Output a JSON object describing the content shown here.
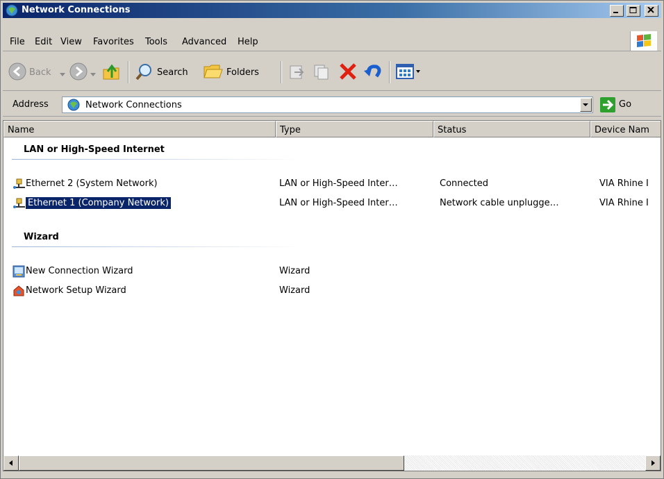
{
  "window": {
    "title": "Network Connections"
  },
  "menu": [
    "File",
    "Edit",
    "View",
    "Favorites",
    "Tools",
    "Advanced",
    "Help"
  ],
  "toolbar": {
    "back_label": "Back",
    "search_label": "Search",
    "folders_label": "Folders"
  },
  "address": {
    "label": "Address",
    "value": "Network Connections",
    "go_label": "Go"
  },
  "columns": [
    "Name",
    "Type",
    "Status",
    "Device Nam"
  ],
  "groups": [
    {
      "title": "LAN or High-Speed Internet",
      "items": [
        {
          "name": "Ethernet 2 (System Network)",
          "type": "LAN or High-Speed Inter…",
          "status": "Connected",
          "device": "VIA Rhine I",
          "icon": "lan-connection-icon",
          "selected": false
        },
        {
          "name": "Ethernet 1 (Company Network)",
          "type": "LAN or High-Speed Inter…",
          "status": "Network cable unplugge…",
          "device": "VIA Rhine I",
          "icon": "lan-connection-icon",
          "selected": true
        }
      ]
    },
    {
      "title": "Wizard",
      "items": [
        {
          "name": "New Connection Wizard",
          "type": "Wizard",
          "status": "",
          "device": "",
          "icon": "new-connection-wizard-icon",
          "selected": false
        },
        {
          "name": "Network Setup Wizard",
          "type": "Wizard",
          "status": "",
          "device": "",
          "icon": "network-setup-wizard-icon",
          "selected": false
        }
      ]
    }
  ],
  "colors": {
    "selection": "#0a246a",
    "titlebar": "#0a246a",
    "chrome": "#d4d0c8"
  }
}
